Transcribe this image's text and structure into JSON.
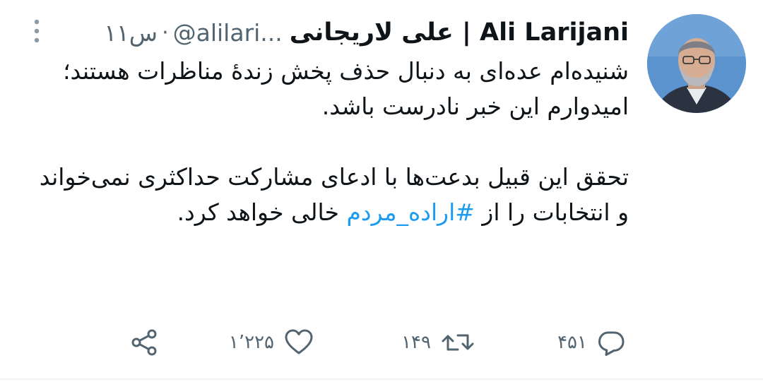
{
  "tweet": {
    "display_name": "علی لاریجانی | Ali Larijani",
    "handle": "@alilari...",
    "separator": "·",
    "time": "۱۱س",
    "body": {
      "para1": "شنیده‌ام عده‌ای به دنبال حذف پخش زندهٔ مناظرات هستند؛ امیدوارم این خبر نادرست باشد.",
      "para2_start": "تحقق این قبیل بدعت‌ها با ادعای مشارکت حداکثری نمی‌خواند و انتخابات را از ",
      "hashtag": "#اراده_مردم",
      "para2_end": " خالی خواهد کرد."
    },
    "actions": {
      "reply_count": "۴۵۱",
      "retweet_count": "۱۴۹",
      "like_count": "۱٬۲۲۵"
    },
    "colors": {
      "text": "#0f1419",
      "secondary": "#536471",
      "link": "#1d9bf0"
    },
    "icons": [
      "more-icon",
      "reply-icon",
      "retweet-icon",
      "like-icon",
      "share-icon"
    ]
  }
}
